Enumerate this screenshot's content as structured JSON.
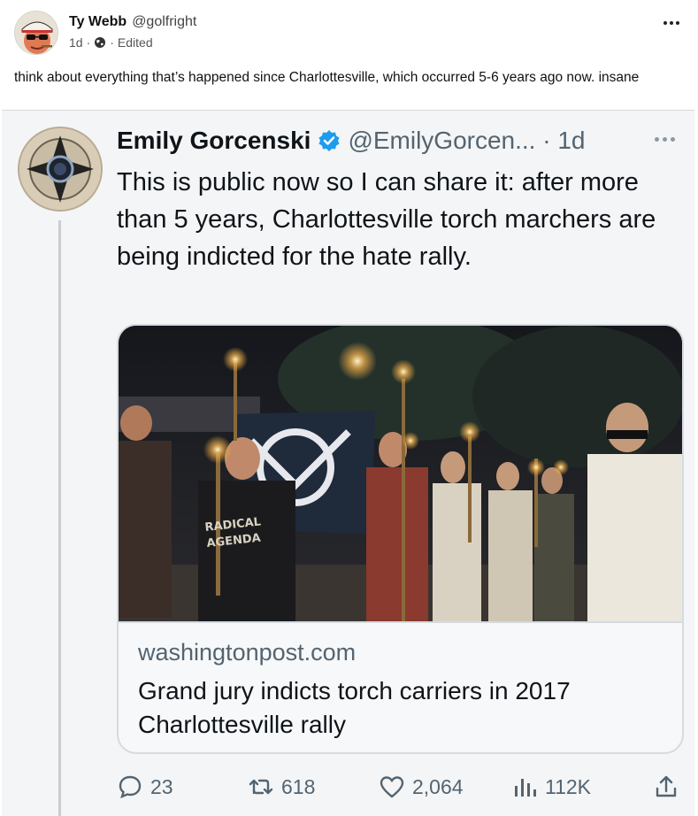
{
  "post": {
    "author_name": "Ty Webb",
    "author_handle": "@golfright",
    "age": "1d",
    "edited_label": "Edited",
    "text": "think about everything that’s happened since Charlottesville, which occurred 5-6 years ago now. insane"
  },
  "embedded_tweet": {
    "author_name": "Emily Gorcenski",
    "handle_and_time": "@EmilyGorcen... · 1d",
    "body": "This is public now so I can share it: after more than 5 years, Charlottesville torch marchers are being indicted for the hate rally.",
    "link_card": {
      "domain": "washingtonpost.com",
      "title": "Grand jury indicts torch carriers in 2017 Charlottesville rally"
    },
    "actions": {
      "replies": "23",
      "reposts": "618",
      "likes": "2,064",
      "views": "112K"
    }
  },
  "image_text": {
    "shirt_text": "RADICAL AGENDA"
  },
  "colors": {
    "verified_badge": "#1d9bf0",
    "secondary_text": "#536471"
  }
}
